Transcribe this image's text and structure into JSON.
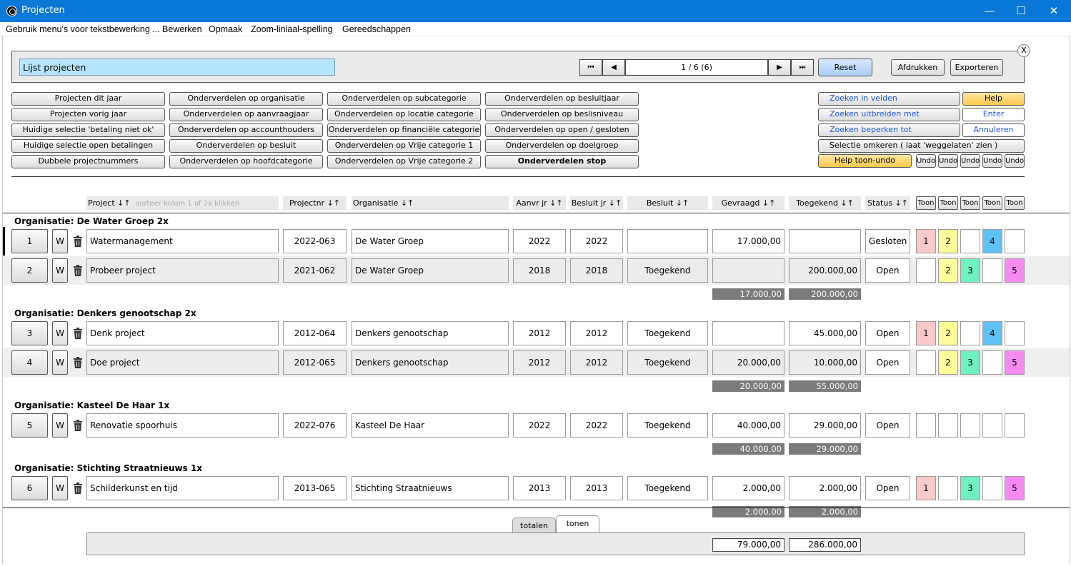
{
  "window": {
    "title": "Projecten",
    "minimize": "—",
    "maximize": "☐",
    "close": "✕"
  },
  "menu": [
    "Gebruik menu's voor tekstbewerking ...",
    "Bewerken",
    "Opmaak",
    "Zoom-liniaal-spelling",
    "Gereedschappen"
  ],
  "toolbar": {
    "list_title": "Lijst projecten",
    "first": "⏮",
    "prev": "◀",
    "next": "▶",
    "last": "⏭",
    "pager": "1 / 6 (6)",
    "reset": "Reset",
    "print": "Afdrukken",
    "export": "Exporteren",
    "close": "X"
  },
  "filters": {
    "col1": [
      "Projecten dit jaar",
      "Projecten vorig jaar",
      "Huidige selectie 'betaling niet ok'",
      "Huidige selectie open betalingen",
      "Dubbele projectnummers"
    ],
    "col2": [
      "Onderverdelen op organisatie",
      "Onderverdelen op aanvraagjaar",
      "Onderverdelen op accounthouders",
      "Onderverdelen op besluit",
      "Onderverdelen op hoofdcategorie"
    ],
    "col3": [
      "Onderverdelen op subcategorie",
      "Onderverdelen op locatie categorie",
      "Onderverdelen op financiële categorie",
      "Onderverdelen op Vrije categorie 1",
      "Onderverdelen op Vrije categorie 2"
    ],
    "col4": [
      "Onderverdelen op besluitjaar",
      "Onderverdelen op beslisniveau",
      "Onderverdelen op open / gesloten",
      "Onderverdelen op doelgroep",
      "Onderverdelen stop"
    ]
  },
  "search": {
    "in_fields": "Zoeken in velden",
    "extend": "Zoeken uitbreiden met",
    "restrict": "Zoeken beperken tot",
    "invert": "Selectie omkeren ( laat 'weggelaten' zien )",
    "help_toggle": "Help toon-undo",
    "help": "Help",
    "enter": "Enter",
    "cancel": "Annuleren",
    "undo": "Undo"
  },
  "columns": {
    "project": "Project ↓↑",
    "sort_hint": "sorteer kolom 1 of 2x klikken",
    "projectnr": "Projectnr ↓↑",
    "organisatie": "Organisatie ↓↑",
    "aanvr": "Aanvr jr ↓↑",
    "besluit_jr": "Besluit jr ↓↑",
    "besluit": "Besluit ↓↑",
    "gevraagd": "Gevraagd ↓↑",
    "toegekend": "Toegekend ↓↑",
    "status": "Status ↓↑",
    "toon": "Toon"
  },
  "row_w": "W",
  "groups": [
    {
      "title": "Organisatie: De Water Groep  2x",
      "rows": [
        {
          "nr": "1",
          "project": "Watermanagement",
          "projectnr": "2022-063",
          "org": "De Water Groep",
          "aanvr": "2022",
          "besluit_jr": "2022",
          "besluit": "",
          "gevraagd": "17.000,00",
          "toegekend": "",
          "status": "Gesloten",
          "tags": [
            "1",
            "2",
            "",
            "4",
            ""
          ]
        },
        {
          "nr": "2",
          "project": "Probeer project",
          "projectnr": "2021-062",
          "org": "De Water Groep",
          "aanvr": "2018",
          "besluit_jr": "2018",
          "besluit": "Toegekend",
          "gevraagd": "",
          "toegekend": "200.000,00",
          "status": "Open",
          "tags": [
            "",
            "2",
            "3",
            "",
            "5"
          ]
        }
      ],
      "total_gevraagd": "17.000,00",
      "total_toegekend": "200.000,00"
    },
    {
      "title": "Organisatie: Denkers genootschap  2x",
      "rows": [
        {
          "nr": "3",
          "project": "Denk project",
          "projectnr": "2012-064",
          "org": "Denkers genootschap",
          "aanvr": "2012",
          "besluit_jr": "2012",
          "besluit": "Toegekend",
          "gevraagd": "",
          "toegekend": "45.000,00",
          "status": "Open",
          "tags": [
            "1",
            "2",
            "",
            "4",
            ""
          ]
        },
        {
          "nr": "4",
          "project": "Doe project",
          "projectnr": "2012-065",
          "org": "Denkers genootschap",
          "aanvr": "2012",
          "besluit_jr": "2012",
          "besluit": "Toegekend",
          "gevraagd": "20.000,00",
          "toegekend": "10.000,00",
          "status": "Open",
          "tags": [
            "",
            "2",
            "3",
            "",
            "5"
          ]
        }
      ],
      "total_gevraagd": "20.000,00",
      "total_toegekend": "55.000,00"
    },
    {
      "title": "Organisatie: Kasteel De Haar  1x",
      "rows": [
        {
          "nr": "5",
          "project": "Renovatie spoorhuis",
          "projectnr": "2022-076",
          "org": "Kasteel De Haar",
          "aanvr": "2022",
          "besluit_jr": "2022",
          "besluit": "Toegekend",
          "gevraagd": "40.000,00",
          "toegekend": "29.000,00",
          "status": "Open",
          "tags": [
            "",
            "",
            "",
            "",
            ""
          ]
        }
      ],
      "total_gevraagd": "40.000,00",
      "total_toegekend": "29.000,00"
    },
    {
      "title": "Organisatie: Stichting Straatnieuws  1x",
      "rows": [
        {
          "nr": "6",
          "project": "Schilderkunst en tijd",
          "projectnr": "2013-065",
          "org": "Stichting Straatnieuws",
          "aanvr": "2013",
          "besluit_jr": "2013",
          "besluit": "Toegekend",
          "gevraagd": "2.000,00",
          "toegekend": "2.000,00",
          "status": "Open",
          "tags": [
            "1",
            "",
            "3",
            "",
            "5"
          ]
        }
      ],
      "total_gevraagd": "2.000,00",
      "total_toegekend": "2.000,00"
    }
  ],
  "bottom": {
    "tab_totals": "totalen",
    "tab_show": "tonen",
    "sum_gevraagd": "79.000,00",
    "sum_toegekend": "286.000,00"
  },
  "colors": {
    "titlebar": "#0a78d7",
    "list_title_bg": "#b6e6ff",
    "help_bg": "#ffc94d",
    "total_bg": "#7b7b7b",
    "tag1": "#f9c9c9",
    "tag2": "#fbfb9a",
    "tag3": "#6ff0c0",
    "tag4": "#5ec1f7",
    "tag5": "#f78af2"
  }
}
